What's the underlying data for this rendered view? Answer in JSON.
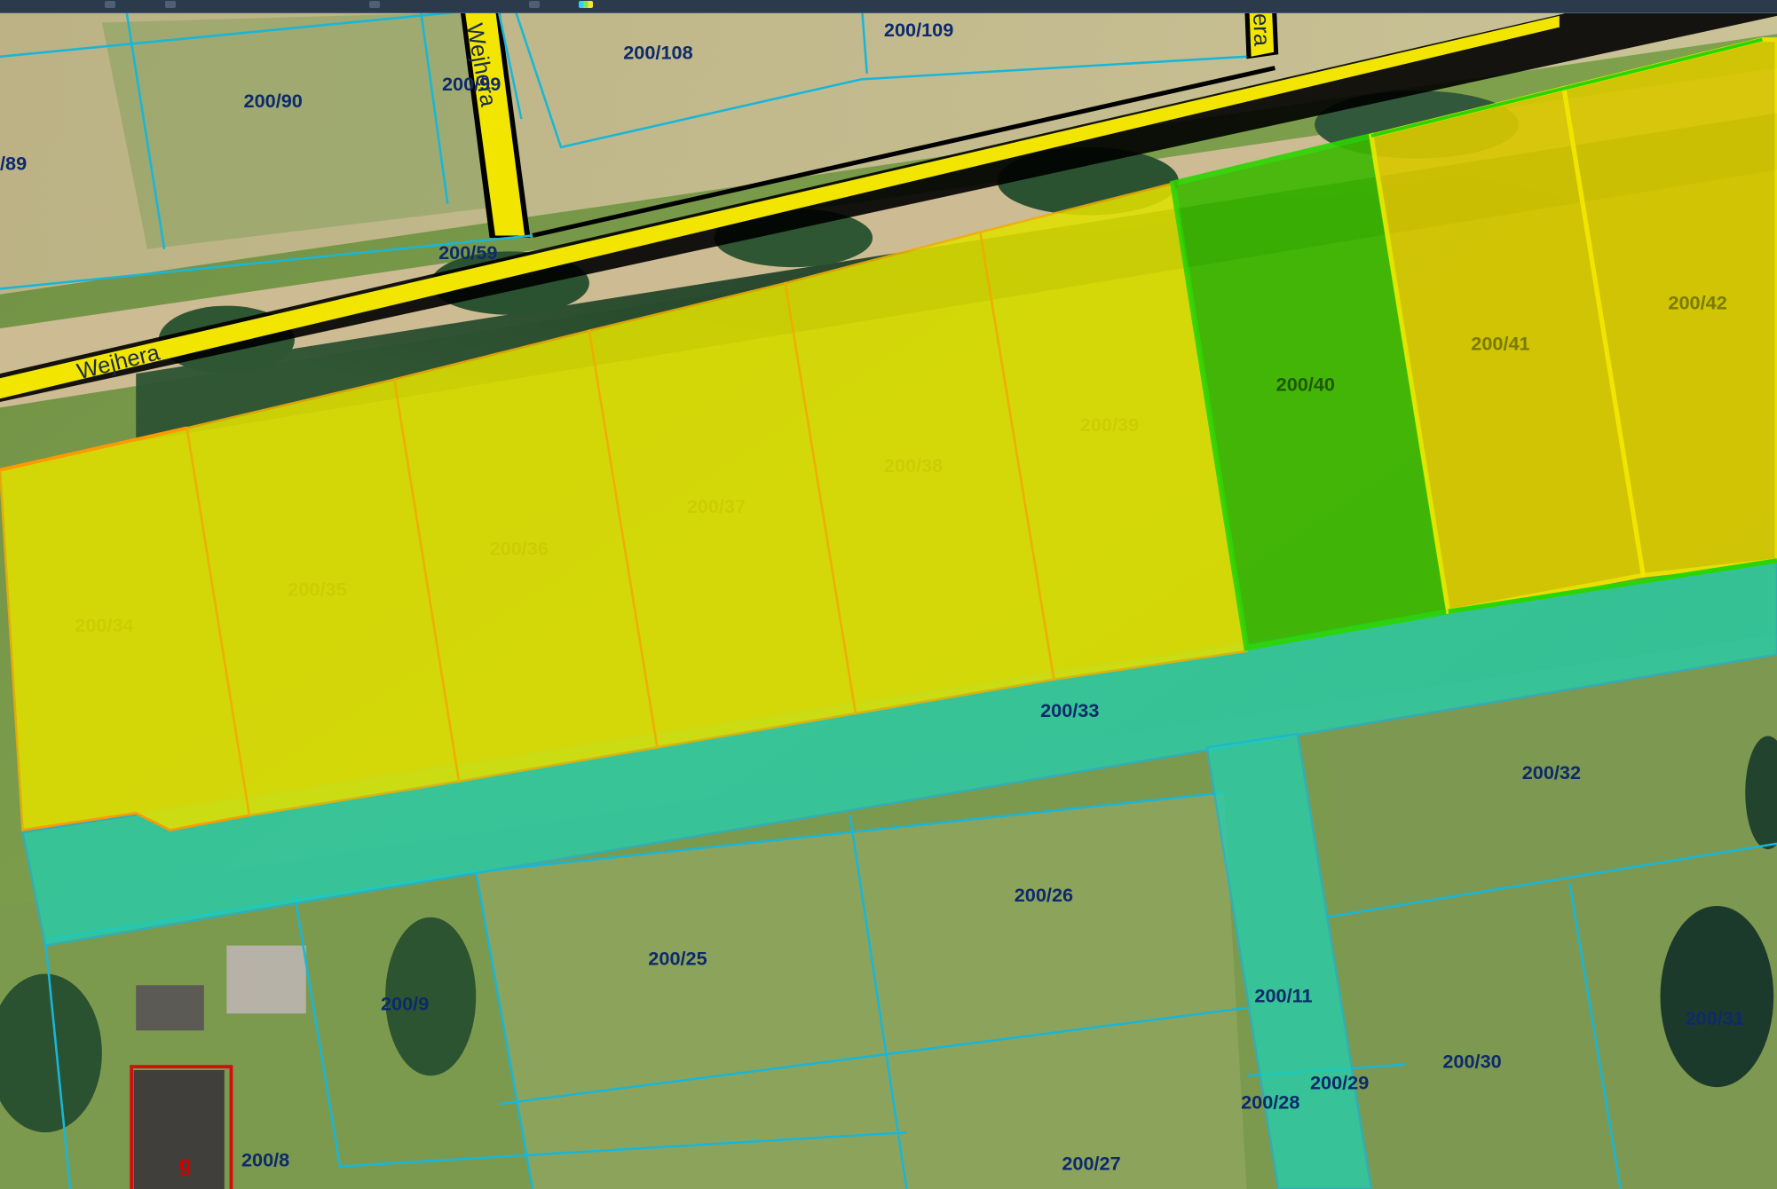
{
  "toolbar": {
    "icons": [
      "tool-icon-1",
      "tool-icon-2",
      "tool-icon-3",
      "tool-icon-4",
      "legend-icon"
    ],
    "accent": "#2b3b4c"
  },
  "map": {
    "streets": [
      {
        "id": "wejhera-main",
        "label": "Wejhera"
      },
      {
        "id": "wejhera-side",
        "label": "Wejhera"
      },
      {
        "id": "wejhera-top",
        "label": "era"
      }
    ],
    "parcels": {
      "p200_109": "200/109",
      "p200_108": "200/108",
      "p200_99": "200/99",
      "p200_90": "200/90",
      "p200_89": "/89",
      "p200_59": "200/59",
      "p200_34": "200/34",
      "p200_35": "200/35",
      "p200_36": "200/36",
      "p200_37": "200/37",
      "p200_38": "200/38",
      "p200_39": "200/39",
      "p200_40": "200/40",
      "p200_41": "200/41",
      "p200_42": "200/42",
      "p200_33": "200/33",
      "p200_32": "200/32",
      "p200_26": "200/26",
      "p200_25": "200/25",
      "p200_9": "200/9",
      "p200_11": "200/11",
      "p200_31": "200/31",
      "p200_30": "200/30",
      "p200_29": "200/29",
      "p200_28": "200/28",
      "p200_27": "200/27",
      "p200_8": "200/8"
    },
    "building_letter": "g",
    "colors": {
      "yellow": "#e0e000",
      "green": "#3cb800",
      "gold": "#d8c800",
      "teal": "#1fd2b4",
      "boundary": "#19b6d8",
      "road": "#f2e600",
      "building": "#d01010"
    }
  }
}
